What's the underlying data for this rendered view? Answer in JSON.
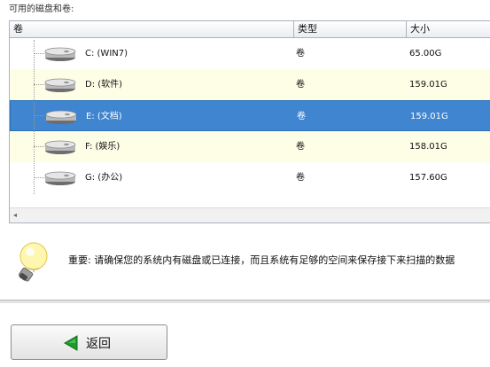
{
  "caption": "可用的磁盘和卷:",
  "table": {
    "columns": [
      "卷",
      "类型",
      "大小"
    ],
    "rows": [
      {
        "volume": "C: (WIN7)",
        "type": "卷",
        "size": "65.00G",
        "selected": false
      },
      {
        "volume": "D: (软件)",
        "type": "卷",
        "size": "159.01G",
        "selected": false
      },
      {
        "volume": "E: (文档)",
        "type": "卷",
        "size": "159.01G",
        "selected": true
      },
      {
        "volume": "F: (娱乐)",
        "type": "卷",
        "size": "158.01G",
        "selected": false
      },
      {
        "volume": "G: (办公)",
        "type": "卷",
        "size": "157.60G",
        "selected": false
      }
    ],
    "scroll_arrow": "◂"
  },
  "notice": "重要: 请确保您的系统内有磁盘或已连接，而且系统有足够的空间来保存接下来扫描的数据",
  "back_button": {
    "label": "返回",
    "icon": "green-left-arrow-icon"
  },
  "colors": {
    "selection": "#3f85cf",
    "alt_row": "#fefee7",
    "arrow": "#1e9a2c"
  }
}
